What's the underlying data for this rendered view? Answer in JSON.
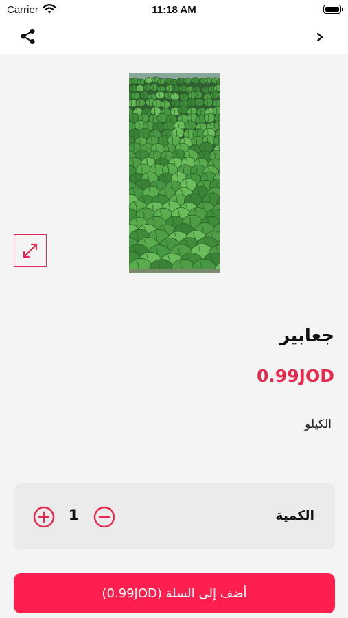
{
  "status_bar": {
    "carrier": "Carrier",
    "time": "11:18 AM"
  },
  "nav": {
    "share_icon": "share-icon",
    "back_icon": "chevron-right-icon"
  },
  "product": {
    "image_alt": "watermelons",
    "name": "جعابير",
    "price": "0.99JOD",
    "unit": "الكيلو"
  },
  "quantity": {
    "label": "الكمية",
    "value": "1"
  },
  "cart": {
    "button_label": "أضف إلى السلة (0.99JOD)"
  },
  "colors": {
    "accent": "#e8294f",
    "button": "#ff1f4e",
    "background": "#f4f4f4",
    "card": "#ebebeb"
  }
}
